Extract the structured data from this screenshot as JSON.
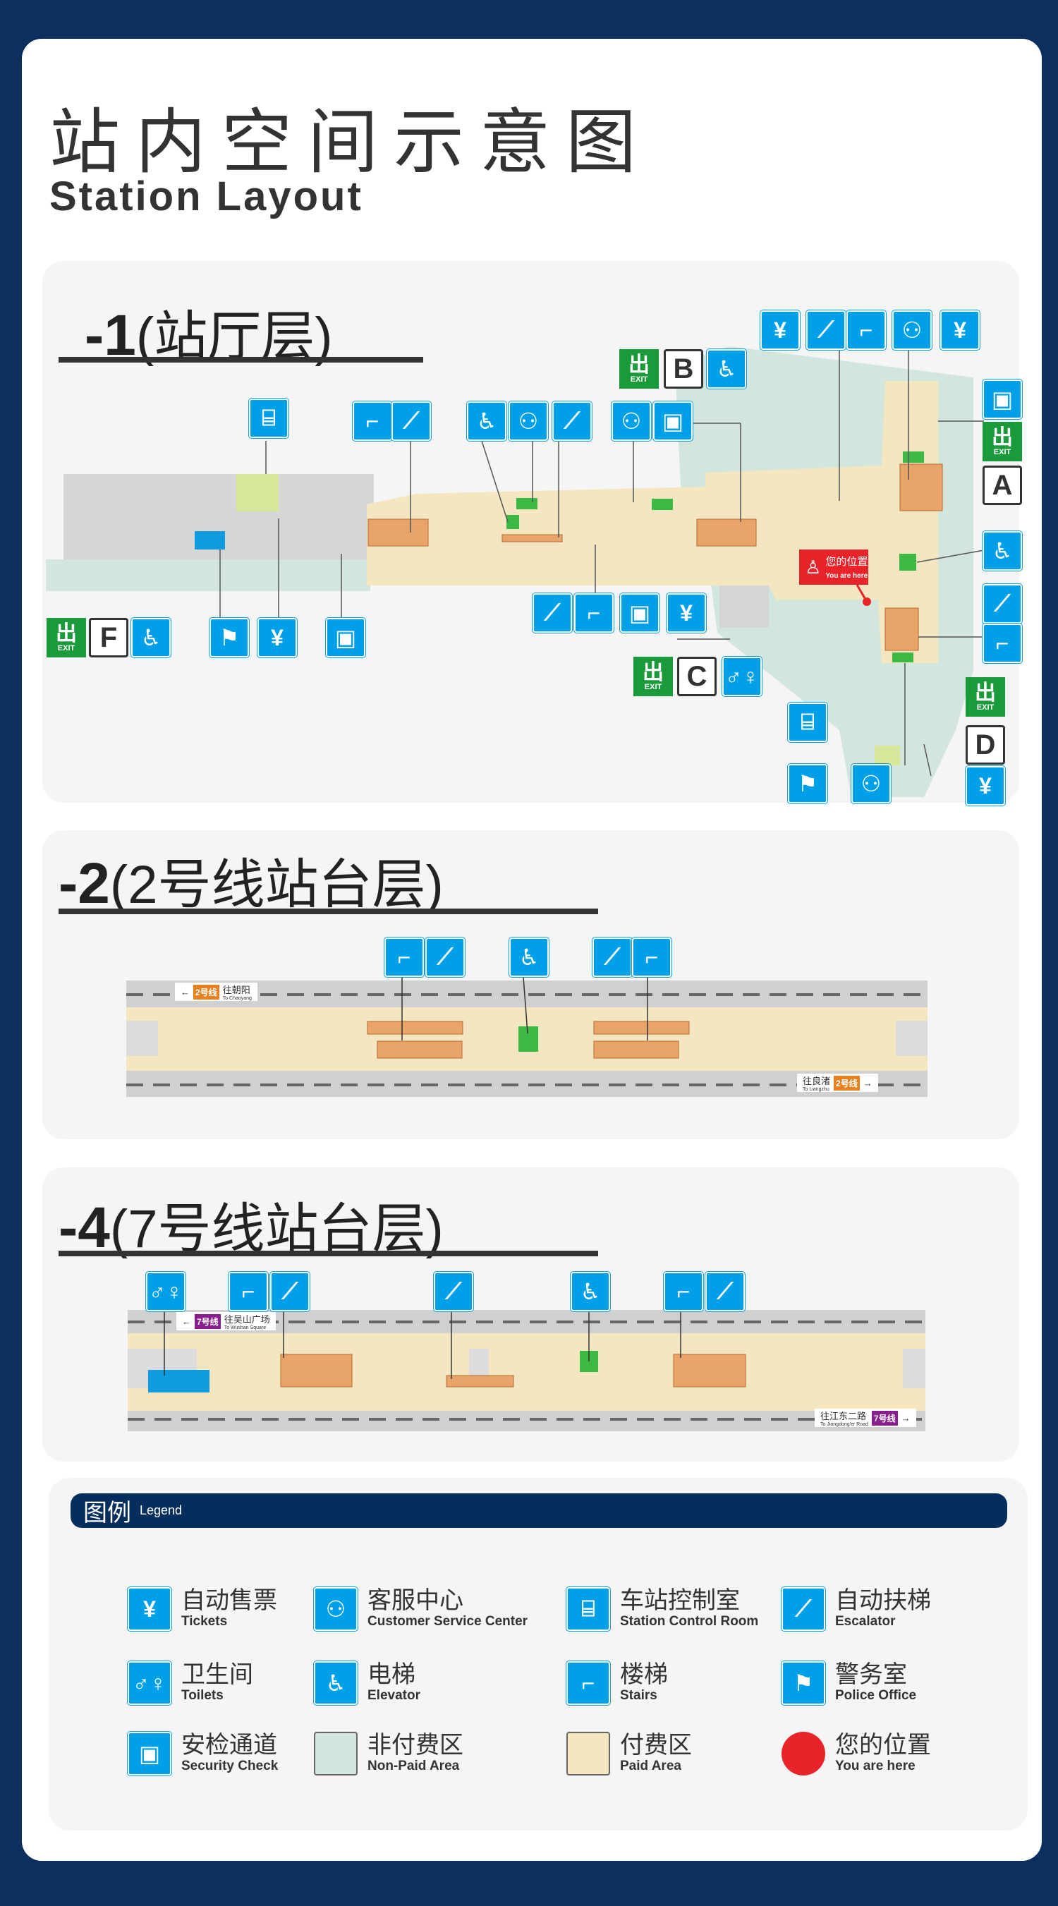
{
  "title": {
    "cn": "站内空间示意图",
    "en": "Station Layout"
  },
  "colors": {
    "background": "#0c2f5e",
    "icon_blue": "#00a0e9",
    "paid_area": "#f4e6c0",
    "non_paid_area": "#d3e6de",
    "exit_green": "#1a9a3a",
    "you_are_here": "#e8242a",
    "escalator": "#e9a46a",
    "elevator": "#3cb944"
  },
  "floors": [
    {
      "num": "-1",
      "name": "(站厅层)",
      "you_are_here": {
        "cn": "您的位置",
        "en": "You are here"
      },
      "exits": [
        {
          "char": "出",
          "en": "EXIT",
          "letter": "B"
        },
        {
          "char": "出",
          "en": "EXIT",
          "letter": "A"
        },
        {
          "char": "出",
          "en": "EXIT",
          "letter": "D"
        },
        {
          "char": "出",
          "en": "EXIT",
          "letter": "C"
        },
        {
          "char": "出",
          "en": "EXIT",
          "letter": "F"
        }
      ],
      "icons": [
        "station-control-room-icon",
        "stairs-icon",
        "escalator-icon",
        "elevator-icon",
        "customer-service-icon",
        "escalator-icon",
        "customer-service-icon",
        "security-check-icon",
        "elevator-icon",
        "tickets-icon",
        "escalator-icon",
        "stairs-icon",
        "customer-service-icon",
        "tickets-icon",
        "security-check-icon",
        "elevator-icon",
        "escalator-icon",
        "stairs-icon",
        "tickets-icon",
        "customer-service-icon",
        "police-office-icon",
        "station-control-room-icon",
        "escalator-icon",
        "stairs-icon",
        "security-check-icon",
        "tickets-icon",
        "toilets-icon",
        "elevator-icon",
        "police-office-icon",
        "tickets-icon",
        "security-check-icon"
      ]
    },
    {
      "num": "-2",
      "name": "(2号线站台层)",
      "directions": [
        {
          "cn": "往朝阳",
          "en": "To Chaoyang",
          "line": "2号线"
        },
        {
          "cn": "往良渚",
          "en": "To Liangzhu",
          "line": "2号线"
        }
      ],
      "line_color": "#e8801e",
      "icons": [
        "stairs-icon",
        "escalator-icon",
        "elevator-icon",
        "escalator-icon",
        "stairs-icon"
      ]
    },
    {
      "num": "-4",
      "name": "(7号线站台层)",
      "directions": [
        {
          "cn": "往吴山广场",
          "en": "To Wushan Square",
          "line": "7号线"
        },
        {
          "cn": "往江东二路",
          "en": "To Jiangdong'er Road",
          "line": "7号线"
        }
      ],
      "line_color": "#8a1e8f",
      "icons": [
        "toilets-icon",
        "stairs-icon",
        "escalator-icon",
        "escalator-icon",
        "elevator-icon",
        "stairs-icon",
        "escalator-icon"
      ]
    }
  ],
  "legend": {
    "title_cn": "图例",
    "title_en": "Legend",
    "items": [
      {
        "cn": "自动售票",
        "en": "Tickets",
        "icon": "tickets-icon"
      },
      {
        "cn": "客服中心",
        "en": "Customer Service Center",
        "icon": "customer-service-icon"
      },
      {
        "cn": "车站控制室",
        "en": "Station Control Room",
        "icon": "station-control-room-icon"
      },
      {
        "cn": "自动扶梯",
        "en": "Escalator",
        "icon": "escalator-icon"
      },
      {
        "cn": "卫生间",
        "en": "Toilets",
        "icon": "toilets-icon"
      },
      {
        "cn": "电梯",
        "en": "Elevator",
        "icon": "elevator-icon"
      },
      {
        "cn": "楼梯",
        "en": "Stairs",
        "icon": "stairs-icon"
      },
      {
        "cn": "警务室",
        "en": "Police Office",
        "icon": "police-office-icon"
      },
      {
        "cn": "安检通道",
        "en": "Security Check",
        "icon": "security-check-icon"
      },
      {
        "cn": "非付费区",
        "en": "Non-Paid Area",
        "icon": "non-paid-area-swatch"
      },
      {
        "cn": "付费区",
        "en": "Paid Area",
        "icon": "paid-area-swatch"
      },
      {
        "cn": "您的位置",
        "en": "You are here",
        "icon": "you-are-here-dot"
      }
    ]
  }
}
